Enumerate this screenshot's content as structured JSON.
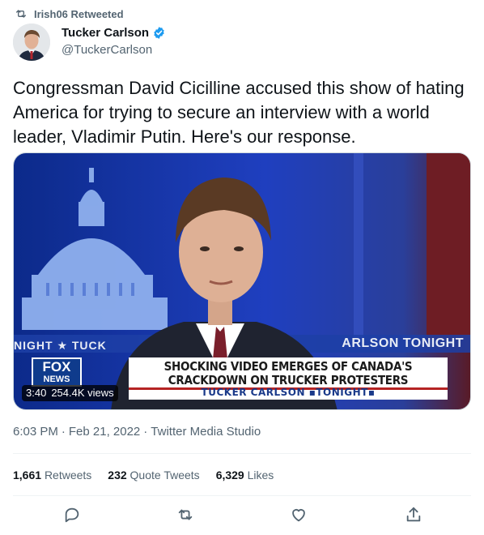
{
  "retweet_context": {
    "icon": "retweet-icon",
    "text": "Irish06 Retweeted"
  },
  "author": {
    "display_name": "Tucker Carlson",
    "handle": "@TuckerCarlson",
    "verified": true,
    "verified_color": "#1d9bf0"
  },
  "tweet": {
    "text": "Congressman David Cicilline accused this show of hating America for trying to secure an interview with a world leader, Vladimir Putin. Here's our response."
  },
  "media": {
    "chyron_line1": "SHOCKING VIDEO EMERGES OF CANADA'S",
    "chyron_line2": "CRACKDOWN ON TRUCKER PROTESTERS",
    "chyron_show": "TUCKER CARLSON ▪TONIGHT▪",
    "ticker_left": "NIGHT ★ TUCK",
    "ticker_right": "ARLSON TONIGHT",
    "network_logo_top": "FOX",
    "network_logo_bottom": "NEWS",
    "duration": "3:40",
    "views": "254.4K views"
  },
  "meta": {
    "time": "6:03 PM",
    "date": "Feb 21, 2022",
    "source": "Twitter Media Studio",
    "separator": "·"
  },
  "stats": {
    "retweets_count": "1,661",
    "retweets_label": "Retweets",
    "quotes_count": "232",
    "quotes_label": "Quote Tweets",
    "likes_count": "6,329",
    "likes_label": "Likes"
  },
  "actions": {
    "reply_icon": "reply-icon",
    "retweet_icon": "retweet-icon",
    "like_icon": "heart-icon",
    "share_icon": "share-icon",
    "icon_color": "#536471"
  }
}
